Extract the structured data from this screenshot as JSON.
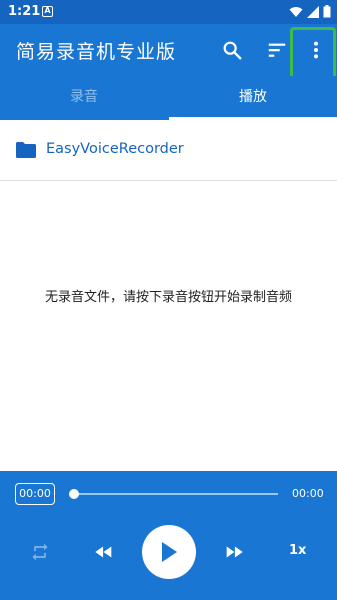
{
  "status_bar": {
    "time": "1:21",
    "notification_glyph": "A",
    "icons": [
      "wifi-icon",
      "signal-icon",
      "battery-icon"
    ]
  },
  "app_bar": {
    "title": "简易录音机专业版",
    "actions": [
      "search-icon",
      "sort-icon",
      "more-vert-icon"
    ]
  },
  "tabs": [
    {
      "label": "录音",
      "selected": false
    },
    {
      "label": "播放",
      "selected": true
    }
  ],
  "folder": {
    "name": "EasyVoiceRecorder",
    "icon": "folder-icon"
  },
  "empty_message": "无录音文件，请按下录音按钮开始录制音频",
  "player": {
    "current_time": "00:00",
    "total_time": "00:00",
    "progress": 0,
    "speed": "1x",
    "controls": [
      "repeat-icon",
      "rewind-icon",
      "play-icon",
      "fast-forward-icon"
    ]
  },
  "colors": {
    "primary": "#1976d2",
    "primary_dark": "#1565c0",
    "highlight": "#3dbb4d",
    "tab_inactive": "#90bff0"
  }
}
